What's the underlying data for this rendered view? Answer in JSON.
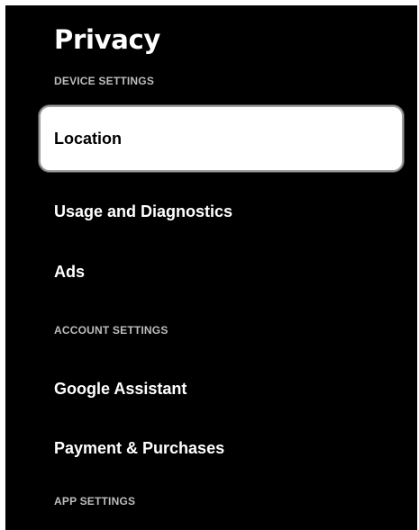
{
  "page": {
    "title": "Privacy"
  },
  "sections": {
    "device": {
      "header": "DEVICE SETTINGS",
      "items": [
        "Location",
        "Usage and Diagnostics",
        "Ads"
      ]
    },
    "account": {
      "header": "ACCOUNT SETTINGS",
      "items": [
        "Google Assistant",
        "Payment & Purchases"
      ]
    },
    "app": {
      "header": "APP SETTINGS"
    }
  },
  "focused_item": "Location",
  "colors": {
    "background": "#000000",
    "text": "#ffffff",
    "section_header": "#bdbdbd",
    "focus_background": "#ffffff",
    "focus_text": "#000000"
  }
}
